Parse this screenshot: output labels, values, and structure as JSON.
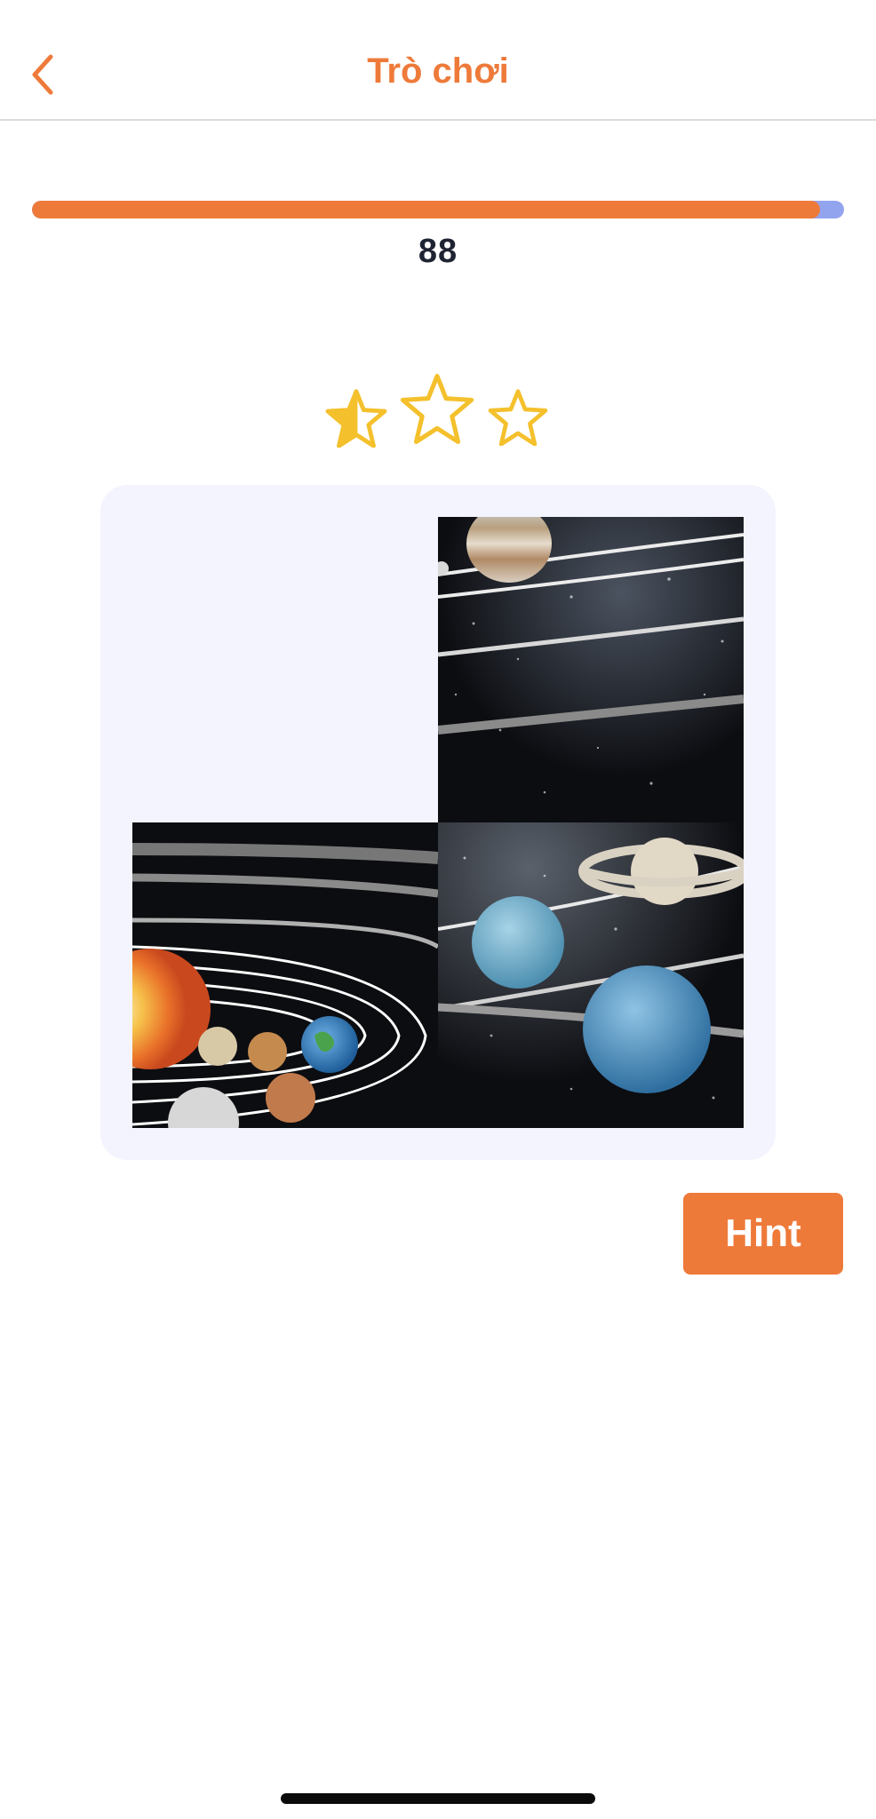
{
  "header": {
    "title": "Trò chơi",
    "back_icon": "chevron-left-icon"
  },
  "progress": {
    "fraction": 0.97,
    "value_text": "88"
  },
  "rating": {
    "stars_total": 3,
    "stars_filled": 0.5,
    "star_icon": "star-icon"
  },
  "puzzle": {
    "grid": "2x2",
    "empty_tile_position": "top-left",
    "tiles": [
      {
        "position": "top-right",
        "content": "jupiter-orbits-tile"
      },
      {
        "position": "bottom-left",
        "content": "sun-inner-planets-tile"
      },
      {
        "position": "bottom-right",
        "content": "saturn-uranus-neptune-tile"
      }
    ]
  },
  "hint": {
    "label": "Hint"
  },
  "colors": {
    "accent": "#ee7a3a",
    "progress_remaining": "#93a4ee",
    "star": "#f4c02c",
    "board": "#f3f4fd"
  }
}
